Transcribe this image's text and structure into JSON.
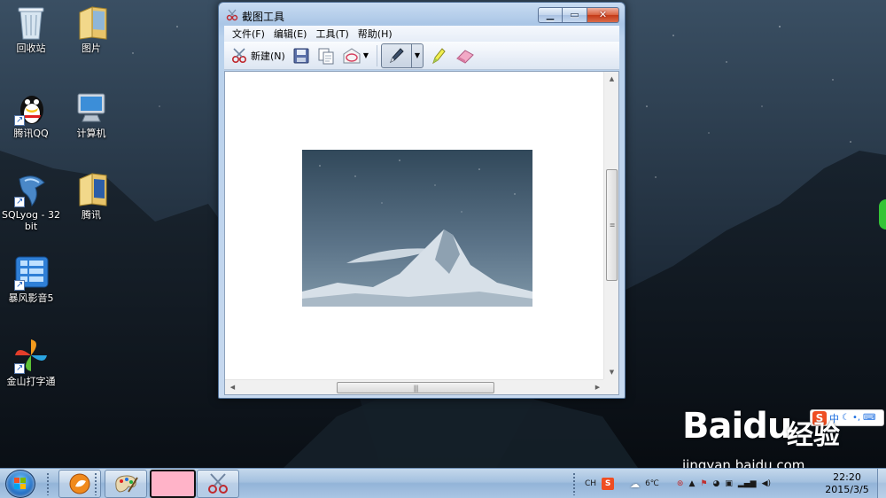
{
  "desktop": {
    "icons": [
      {
        "label": "回收站"
      },
      {
        "label": "图片"
      },
      {
        "label": "腾讯QQ"
      },
      {
        "label": "计算机"
      },
      {
        "label": "SQLyog - 32 bit"
      },
      {
        "label": "腾讯"
      },
      {
        "label": "暴风影音5"
      },
      {
        "label": "金山打字通"
      }
    ]
  },
  "window": {
    "title": "截图工具",
    "caption_buttons": {
      "minimize": "▁",
      "maximize": "▭",
      "close": "✕"
    },
    "menu": [
      "文件(F)",
      "编辑(E)",
      "工具(T)",
      "帮助(H)"
    ],
    "toolbar": {
      "new_label": "新建(N)",
      "tools": [
        "save-icon",
        "copy-icon",
        "send-email-icon",
        "pen-icon",
        "highlighter-icon",
        "eraser-icon"
      ]
    }
  },
  "ime": {
    "logo": "S",
    "mode": "中"
  },
  "watermark": {
    "logo": "Baidu",
    "suffix": "经验",
    "url": "jingyan.baidu.com"
  },
  "taskbar": {
    "tray": {
      "lang": "CH",
      "temperature": "6℃"
    },
    "clock": {
      "time": "22:20",
      "date": "2015/3/5"
    }
  },
  "colors": {
    "taskbar_active": "#ffb3c8",
    "window_frame": "#aac6e6",
    "close_button": "#c43a17",
    "ime_logo": "#ef4e22"
  }
}
